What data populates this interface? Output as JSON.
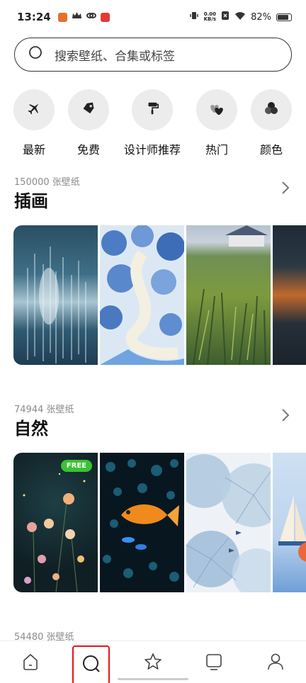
{
  "status_bar": {
    "time": "13:24",
    "net_speed_value": "0.00",
    "net_speed_unit": "KB/s",
    "battery": "82%",
    "battery_level": 0.82
  },
  "search": {
    "placeholder": "搜索壁纸、合集或标签"
  },
  "categories": [
    {
      "label": "最新",
      "icon": "airplane-icon"
    },
    {
      "label": "免费",
      "icon": "tag-icon"
    },
    {
      "label": "设计师推荐",
      "icon": "paint-roller-icon"
    },
    {
      "label": "热门",
      "icon": "hearts-icon"
    },
    {
      "label": "颜色",
      "icon": "color-dots-icon"
    }
  ],
  "sections": [
    {
      "count": "150000",
      "unit": "张壁纸",
      "title": "插画"
    },
    {
      "count": "74944",
      "unit": "张壁纸",
      "title": "自然",
      "badge": "FREE"
    },
    {
      "count": "54480",
      "unit": "张壁纸"
    }
  ],
  "bottom_nav": [
    {
      "icon": "home-icon"
    },
    {
      "icon": "search-icon",
      "active": true
    },
    {
      "icon": "star-icon"
    },
    {
      "icon": "screen-icon"
    },
    {
      "icon": "profile-icon"
    }
  ],
  "colors": {
    "active_highlight": "#e3141b",
    "free_badge": "#3bc232",
    "category_bg": "#ececec"
  }
}
